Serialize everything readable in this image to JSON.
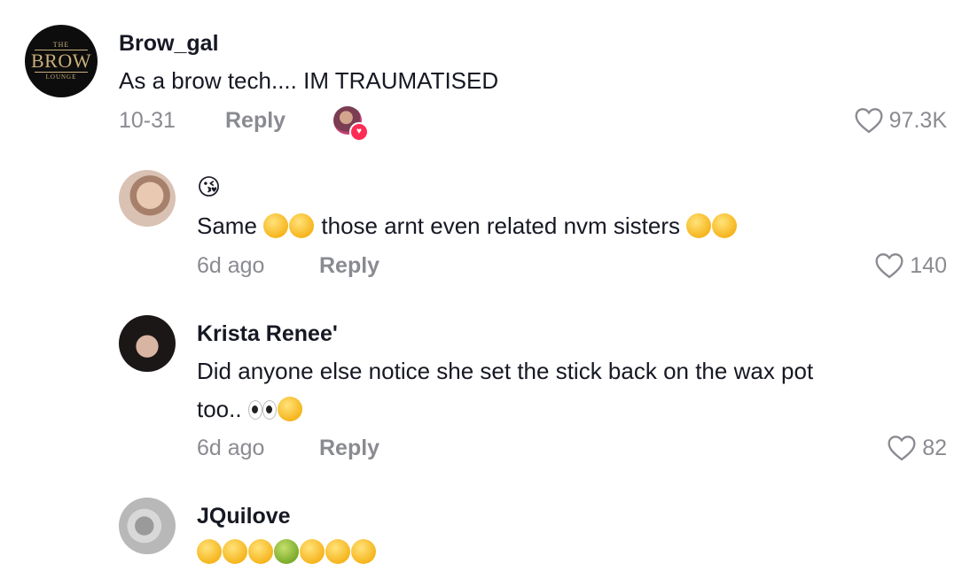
{
  "comments": [
    {
      "username": "Brow_gal",
      "avatar_logo": {
        "line1": "THE",
        "line2": "BROW",
        "line3": "LOUNGE"
      },
      "text": "As a brow tech.... IM TRAUMATISED",
      "date": "10-31",
      "reply_label": "Reply",
      "likes": "97.3K"
    },
    {
      "username": "",
      "emoji_line": "😘",
      "text_a": "Same",
      "text_b": "those arnt even related nvm sisters",
      "date": "6d ago",
      "reply_label": "Reply",
      "likes": "140"
    },
    {
      "username": "Krista Renee'",
      "text_line1": "Did anyone else notice she set the stick back on the wax pot",
      "text_line2": "too..",
      "date": "6d ago",
      "reply_label": "Reply",
      "likes": "82"
    },
    {
      "username": "JQuilove",
      "emojis": [
        "🤔",
        "😵",
        "😵",
        "🤢",
        "😵‍💫",
        "😵‍💫",
        "😵‍💫"
      ]
    }
  ],
  "colors": {
    "heart_badge": "#fe2c55",
    "muted": "#8a8b91",
    "text": "#161823"
  }
}
